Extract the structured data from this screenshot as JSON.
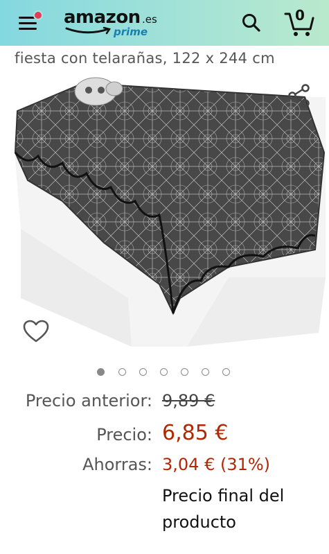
{
  "header": {
    "logo_word": "amazon",
    "logo_suffix": ".es",
    "logo_sub": "prime",
    "cart_count": "0",
    "colors": {
      "accent_dot": "#e23b5d",
      "prime_blue": "#1a7fb0"
    }
  },
  "product": {
    "title_fragment": "fiesta con telarañas, 122 x 244 cm",
    "image_carousel": {
      "total": 7,
      "active_index": 0
    }
  },
  "pricing": {
    "previous_label": "Precio anterior:",
    "previous_value": "9,89 €",
    "price_label": "Precio:",
    "price_value": "6,85 €",
    "savings_label": "Ahorras:",
    "savings_value": "3,04 € (31%)",
    "final_note_line1": "Precio final del",
    "final_note_line2": "producto",
    "colors": {
      "price_red": "#b12704"
    }
  }
}
